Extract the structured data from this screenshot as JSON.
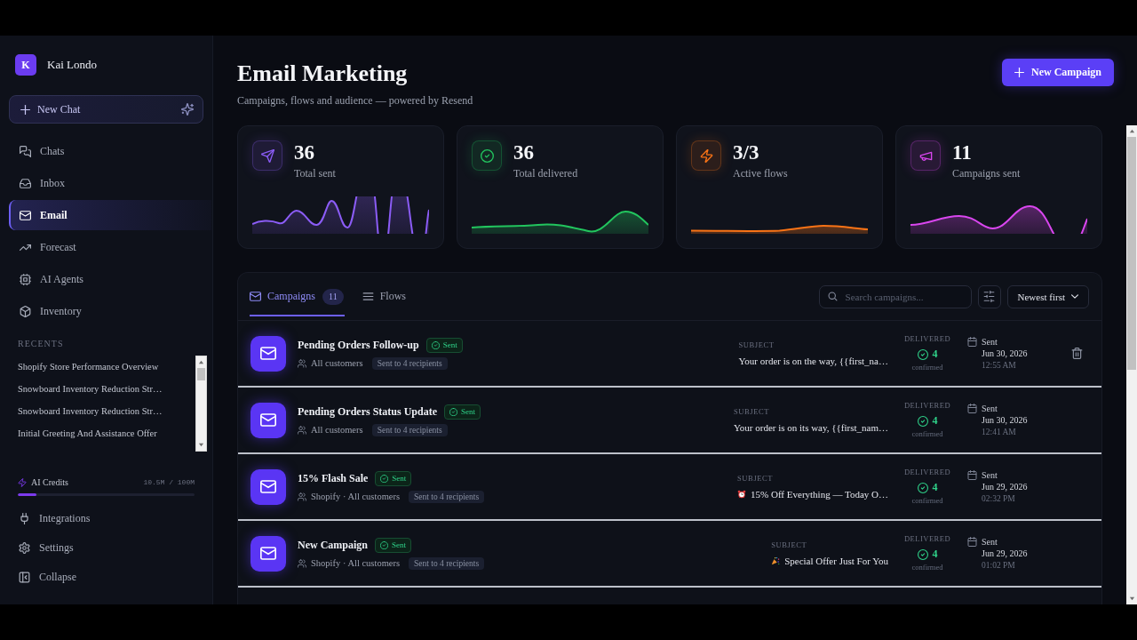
{
  "sidebar": {
    "user": {
      "initial": "K",
      "name": "Kai Londo"
    },
    "new_chat": "New Chat",
    "nav": [
      {
        "label": "Chats",
        "selected": false
      },
      {
        "label": "Inbox",
        "selected": false
      },
      {
        "label": "Email",
        "selected": true
      },
      {
        "label": "Forecast",
        "selected": false
      },
      {
        "label": "AI Agents",
        "selected": false
      },
      {
        "label": "Inventory",
        "selected": false
      }
    ],
    "recents_title": "RECENTS",
    "recents": [
      "Shopify Store Performance Overview",
      "Snowboard Inventory Reduction Str…",
      "Snowboard Inventory Reduction Str…",
      "Initial Greeting And Assistance Offer"
    ],
    "credits": {
      "label": "AI Credits",
      "reading": "10.5M / 100M",
      "level": 0.105
    },
    "footer": [
      "Integrations",
      "Settings",
      "Collapse"
    ]
  },
  "header": {
    "title": "Email Marketing",
    "subtitle": "Campaigns, flows and audience — powered by Resend",
    "action": "New Campaign"
  },
  "stats": [
    {
      "value": "36",
      "label": "Total sent",
      "color": "#8b5cf6"
    },
    {
      "value": "36",
      "label": "Total delivered",
      "color": "#22c55e"
    },
    {
      "value": "3/3",
      "label": "Active flows",
      "color": "#f97316"
    },
    {
      "value": "11",
      "label": "Campaigns sent",
      "color": "#d946ef"
    }
  ],
  "panel": {
    "tabs": [
      {
        "label": "Campaigns",
        "count": "11",
        "selected": true
      },
      {
        "label": "Flows",
        "selected": false
      }
    ],
    "search": {
      "placeholder": "Search campaigns..."
    },
    "sort": "Newest first",
    "rows": [
      {
        "title": "Pending Orders Follow-up",
        "status": "Sent",
        "audience": "All customers",
        "recipients": "Sent to 4 recipients",
        "subject_label": "SUBJECT",
        "subject": {
          "kind": "plain",
          "text": "Your order is on the way, {{first_na…"
        },
        "delivered_label": "DELIVERED",
        "delivered": "4",
        "delivered_note": "confirmed",
        "date_label": "Sent",
        "date": "Jun 30, 2026",
        "time": "12:55 AM",
        "hovered": true
      },
      {
        "title": "Pending Orders Status Update",
        "status": "Sent",
        "audience": "All customers",
        "recipients": "Sent to 4 recipients",
        "subject_label": "SUBJECT",
        "subject": {
          "kind": "plain",
          "text": "Your order is on its way, {{first_nam…"
        },
        "delivered_label": "DELIVERED",
        "delivered": "4",
        "delivered_note": "confirmed",
        "date_label": "Sent",
        "date": "Jun 30, 2026",
        "time": "12:41 AM",
        "hovered": false
      },
      {
        "title": "15% Flash Sale",
        "status": "Sent",
        "audience": "Shopify · All customers",
        "recipients": "Sent to 4 recipients",
        "subject_label": "SUBJECT",
        "subject": {
          "kind": "alarm",
          "text": "15% Off Everything — Today O…"
        },
        "delivered_label": "DELIVERED",
        "delivered": "4",
        "delivered_note": "confirmed",
        "date_label": "Sent",
        "date": "Jun 29, 2026",
        "time": "02:32 PM",
        "hovered": false
      },
      {
        "title": "New Campaign",
        "status": "Sent",
        "audience": "Shopify · All customers",
        "recipients": "Sent to 4 recipients",
        "subject_label": "SUBJECT",
        "subject": {
          "kind": "party",
          "text": "Special Offer Just For You"
        },
        "delivered_label": "DELIVERED",
        "delivered": "4",
        "delivered_note": "confirmed",
        "date_label": "Sent",
        "date": "Jun 29, 2026",
        "time": "01:02 PM",
        "hovered": false
      }
    ]
  }
}
